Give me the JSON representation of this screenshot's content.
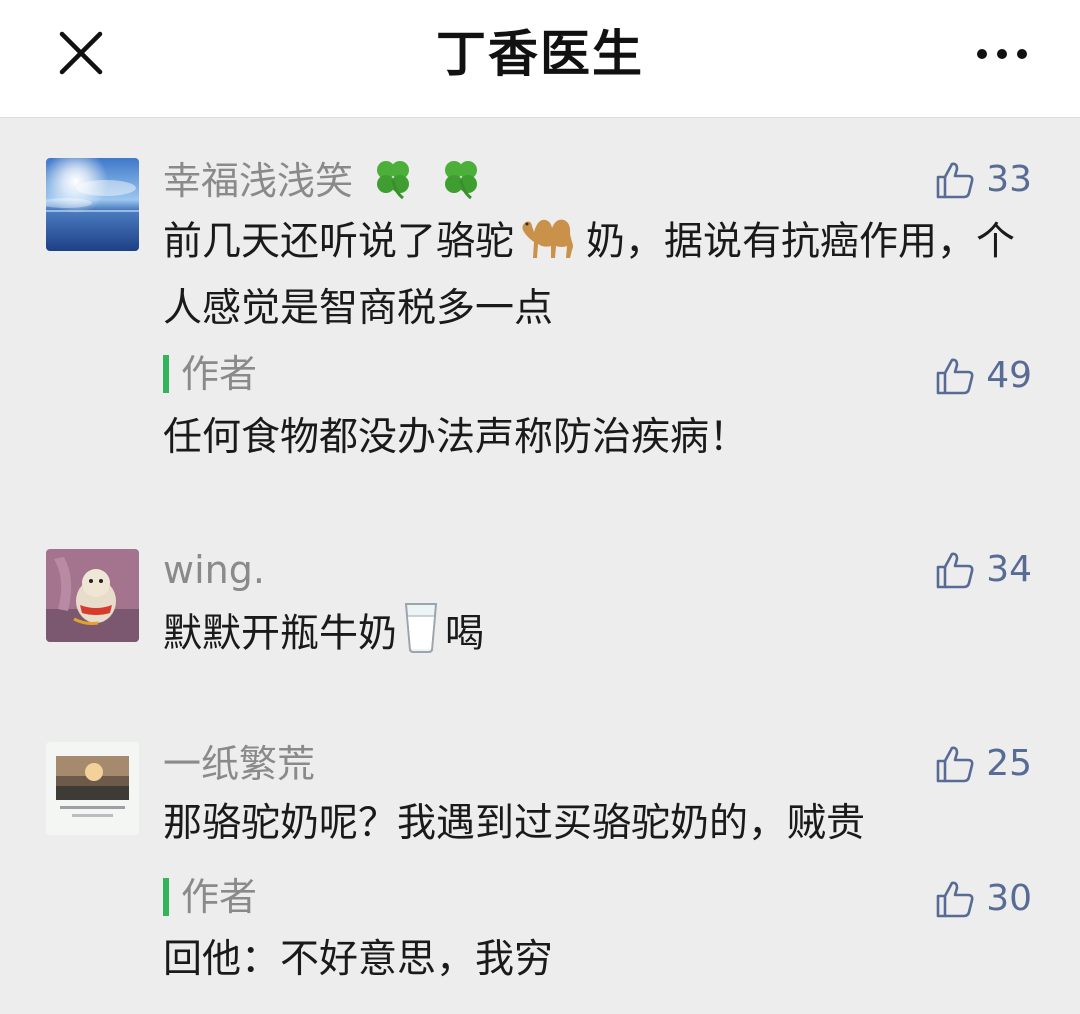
{
  "header": {
    "title": "丁香医生",
    "close_icon": "close-icon",
    "more_icon": "more-dots-icon"
  },
  "colors": {
    "link_blue": "#576b95",
    "author_green": "#33b35a",
    "nickname_gray": "#8a8a8a",
    "background": "#ededed"
  },
  "comments": [
    {
      "nickname": "幸福浅浅笑",
      "nickname_emojis": [
        "four-leaf-clover-icon",
        "four-leaf-clover-icon"
      ],
      "likes": "33",
      "text_before_emoji": "前几天还听说了骆驼",
      "text_emoji": "camel-icon",
      "text_after_emoji": "奶，据说有抗癌作用，个人感觉是智商税多一点",
      "reply": {
        "label": "作者",
        "likes": "49",
        "text": "任何食物都没办法声称防治疾病！"
      }
    },
    {
      "nickname": "wing.",
      "likes": "34",
      "text_before_emoji": "默默开瓶牛奶",
      "text_emoji": "glass-of-milk-icon",
      "text_after_emoji": "喝"
    },
    {
      "nickname": "一纸繁荒",
      "likes": "25",
      "text": "那骆驼奶呢？我遇到过买骆驼奶的，贼贵",
      "reply": {
        "label": "作者",
        "likes": "30",
        "text": "回他：不好意思，我穷"
      }
    }
  ]
}
